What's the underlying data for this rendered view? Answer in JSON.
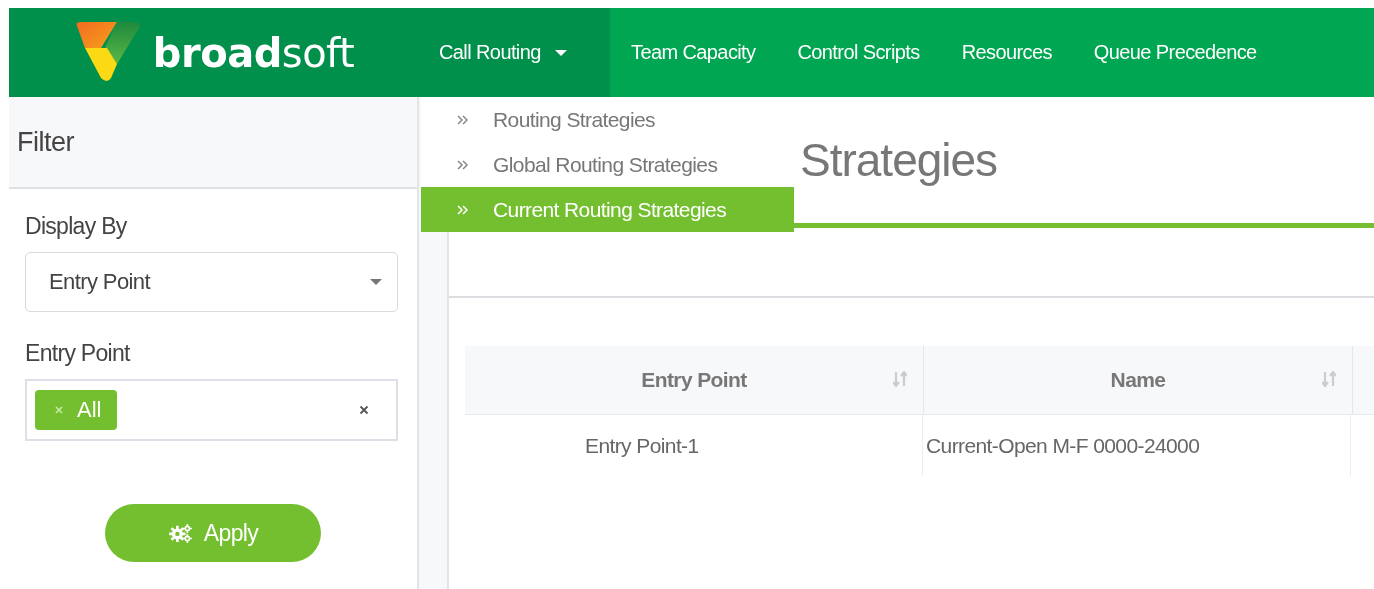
{
  "brand": {
    "name": "**broad**soft"
  },
  "nav": [
    {
      "label": "Call Routing",
      "selected": true,
      "dropdown": true
    },
    {
      "label": "Team Capacity",
      "selected": false,
      "dropdown": false
    },
    {
      "label": "Control Scripts",
      "selected": false,
      "dropdown": false
    },
    {
      "label": "Resources",
      "selected": false,
      "dropdown": false
    },
    {
      "label": "Queue Precedence",
      "selected": false,
      "dropdown": false
    }
  ],
  "menu": [
    {
      "label": "Routing Strategies",
      "selected": false
    },
    {
      "label": "Global Routing Strategies",
      "selected": false
    },
    {
      "label": "Current Routing Strategies",
      "selected": true
    }
  ],
  "sidebar": {
    "title": "Filter",
    "display_by": {
      "label": "Display By",
      "value": "Entry Point"
    },
    "entry_point": {
      "label": "Entry Point",
      "tags": [
        "All"
      ]
    },
    "apply": "Apply"
  },
  "page_title": "Strategies",
  "table": {
    "columns": [
      "Entry Point",
      "Name"
    ],
    "rows": [
      [
        "Entry Point-1",
        "Current-Open M-F 0000-24000"
      ]
    ]
  }
}
